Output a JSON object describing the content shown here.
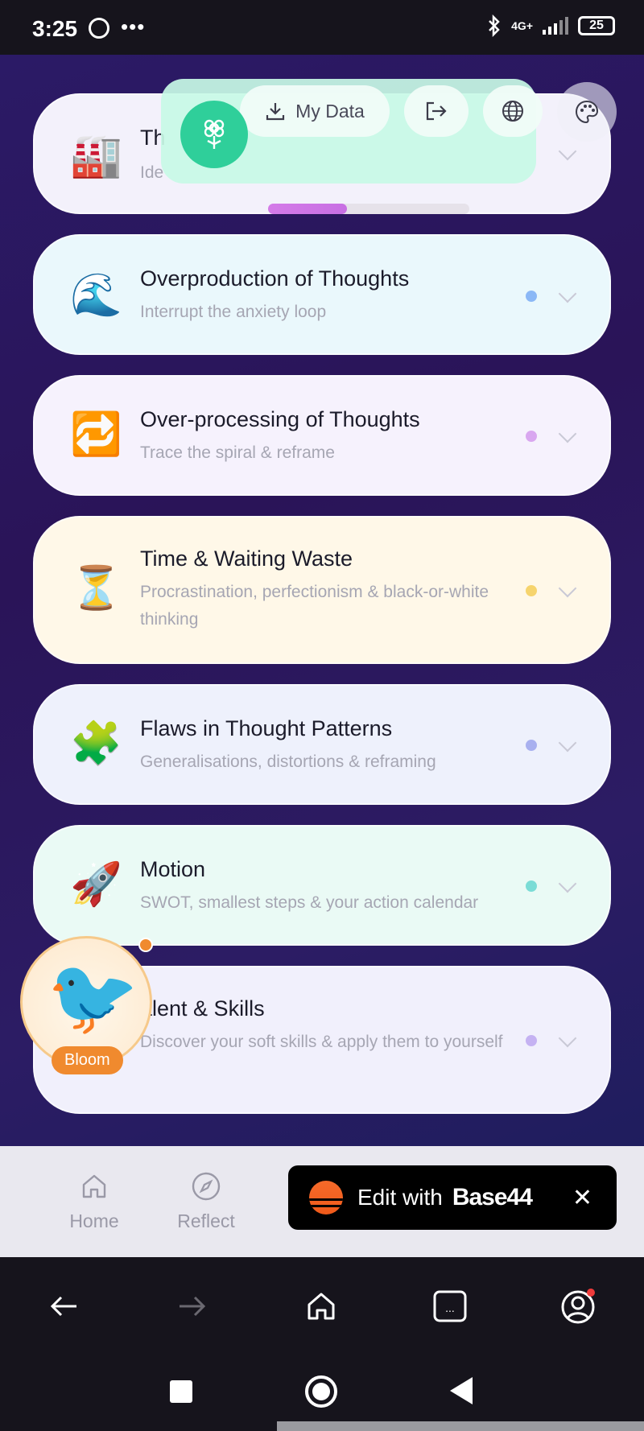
{
  "status_bar": {
    "time": "3:25",
    "more": "•••",
    "network": "4G+",
    "battery": "25"
  },
  "top_panel": {
    "my_data_label": "My Data",
    "progress_fraction": 0.39,
    "icons": [
      "flower-icon",
      "download-icon",
      "logout-icon",
      "globe-icon",
      "palette-icon"
    ]
  },
  "cards": [
    {
      "emoji": "🏭",
      "title": "Th",
      "subtitle": "Ide",
      "dot_color": "#f4a23c",
      "bg": "#f3f1fb"
    },
    {
      "emoji": "🌊",
      "title": "Overproduction of Thoughts",
      "subtitle": "Interrupt the anxiety loop",
      "dot_color": "#8bb8f6",
      "bg": "#eaf8fc"
    },
    {
      "emoji": "🔁",
      "title": "Over-processing of Thoughts",
      "subtitle": "Trace the spiral & reframe",
      "dot_color": "#d9a7f0",
      "bg": "#f6f2fd"
    },
    {
      "emoji": "⏳",
      "title": "Time & Waiting Waste",
      "subtitle": "Procrastination, perfectionism & black-or-white thinking",
      "dot_color": "#f6d46d",
      "bg": "#fff8e8"
    },
    {
      "emoji": "🧩",
      "title": "Flaws in Thought Patterns",
      "subtitle": "Generalisations, distortions & reframing",
      "dot_color": "#a8b0ef",
      "bg": "#eef1fc"
    },
    {
      "emoji": "🚀",
      "title": "Motion",
      "subtitle": "SWOT, smallest steps & your action calendar",
      "dot_color": "#7bdcd6",
      "bg": "#eafaf5"
    },
    {
      "emoji": "",
      "title": "alent & Skills",
      "subtitle": "Discover your soft skills & apply them to yourself",
      "dot_color": "#c5b2f2",
      "bg": "#f1f0fc"
    }
  ],
  "mascot": {
    "label": "Bloom",
    "emoji": "🐦"
  },
  "tabs": [
    {
      "label": "Home",
      "icon": "home-icon"
    },
    {
      "label": "Reflect",
      "icon": "compass-icon"
    }
  ],
  "base44": {
    "edit_label": "Edit with",
    "brand": "Base44",
    "close": "✕"
  },
  "browser_bar": [
    "back-icon",
    "forward-icon",
    "home-icon",
    "tabs-icon",
    "account-icon"
  ],
  "tabs_count": "..."
}
